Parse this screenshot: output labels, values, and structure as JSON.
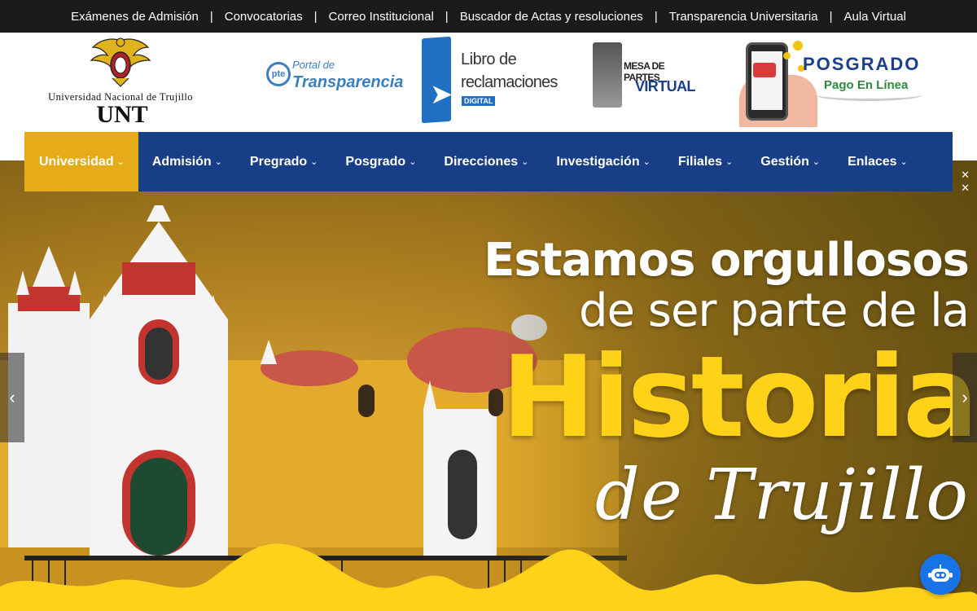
{
  "topbar": {
    "links": [
      "Exámenes de Admisión",
      "Convocatorias",
      "Correo Institucional",
      "Buscador de Actas y resoluciones",
      "Transparencia Universitaria",
      "Aula Virtual"
    ],
    "separator": "|"
  },
  "header": {
    "logo_name": "Universidad Nacional de Trujillo",
    "logo_acronym": "UNT",
    "banners": {
      "transparencia_line1": "Portal de",
      "transparencia_line2": "Transparencia",
      "transparencia_badge": "pte",
      "libro_line1": "Libro de",
      "libro_line2": "reclamaciones",
      "libro_tag": "DIGITAL",
      "mesa_line1": "MESA DE PARTES",
      "mesa_line2": "VIRTUAL",
      "posgrado_line1": "POSGRADO",
      "posgrado_line2": "Pago En Línea"
    }
  },
  "nav": {
    "items": [
      "Universidad",
      "Admisión",
      "Pregrado",
      "Posgrado",
      "Direcciones",
      "Investigación",
      "Filiales",
      "Gestión",
      "Enlaces"
    ],
    "active": "Universidad",
    "chevron": "⌄"
  },
  "hero": {
    "line1": "Estamos orgullosos",
    "line2": "de ser parte de la",
    "line3": "Historia",
    "line4": "de Trujillo",
    "prev_arrow": "‹",
    "next_arrow": "›"
  },
  "colors": {
    "topbar": "#1d1b19",
    "nav": "#173e86",
    "nav_active": "#e6ab18",
    "accent_yellow": "#ffd21a",
    "chat_button": "#1874e6"
  },
  "icons": {
    "chat": "robot-chat-icon",
    "prev": "chevron-left-icon",
    "next": "chevron-right-icon"
  }
}
